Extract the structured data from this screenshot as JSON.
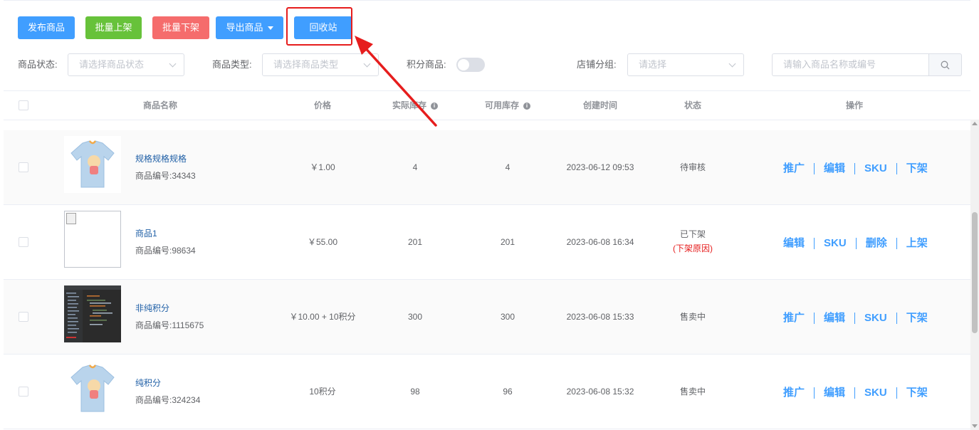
{
  "toolbar": {
    "publish": "发布商品",
    "batch_on": "批量上架",
    "batch_off": "批量下架",
    "export": "导出商品",
    "recycle": "回收站"
  },
  "filters": {
    "status_label": "商品状态:",
    "status_placeholder": "请选择商品状态",
    "type_label": "商品类型:",
    "type_placeholder": "请选择商品类型",
    "points_label": "积分商品:",
    "points_toggle_on": false,
    "group_label": "店铺分组:",
    "group_placeholder": "请选择",
    "search_placeholder": "请输入商品名称或编号"
  },
  "table": {
    "headers": {
      "name": "商品名称",
      "price": "价格",
      "actual_stock": "实际库存",
      "available_stock": "可用库存",
      "created": "创建时间",
      "status": "状态",
      "ops": "操作"
    },
    "rows": [
      {
        "name": "规格规格规格",
        "code": "商品编号:34343",
        "price": "￥1.00",
        "actual_stock": "4",
        "available_stock": "4",
        "created": "2023-06-12 09:53",
        "status": "待审核",
        "ops": [
          "推广",
          "编辑",
          "SKU",
          "下架"
        ]
      },
      {
        "name": "商品1",
        "code": "商品编号:98634",
        "price": "￥55.00",
        "actual_stock": "201",
        "available_stock": "201",
        "created": "2023-06-08 16:34",
        "status": "已下架",
        "status_reason": "(下架原因)",
        "ops": [
          "编辑",
          "SKU",
          "删除",
          "上架"
        ]
      },
      {
        "name": "非纯积分",
        "code": "商品编号:1115675",
        "price": "￥10.00 + 10积分",
        "actual_stock": "300",
        "available_stock": "300",
        "created": "2023-06-08 15:33",
        "status": "售卖中",
        "ops": [
          "推广",
          "编辑",
          "SKU",
          "下架"
        ]
      },
      {
        "name": "纯积分",
        "code": "商品编号:324234",
        "price": "10积分",
        "actual_stock": "98",
        "available_stock": "96",
        "created": "2023-06-08 15:32",
        "status": "售卖中",
        "ops": [
          "推广",
          "编辑",
          "SKU",
          "下架"
        ]
      }
    ]
  },
  "colors": {
    "primary": "#409eff",
    "success": "#67c23a",
    "danger": "#f56c6c",
    "annotation": "#e61d1d"
  }
}
